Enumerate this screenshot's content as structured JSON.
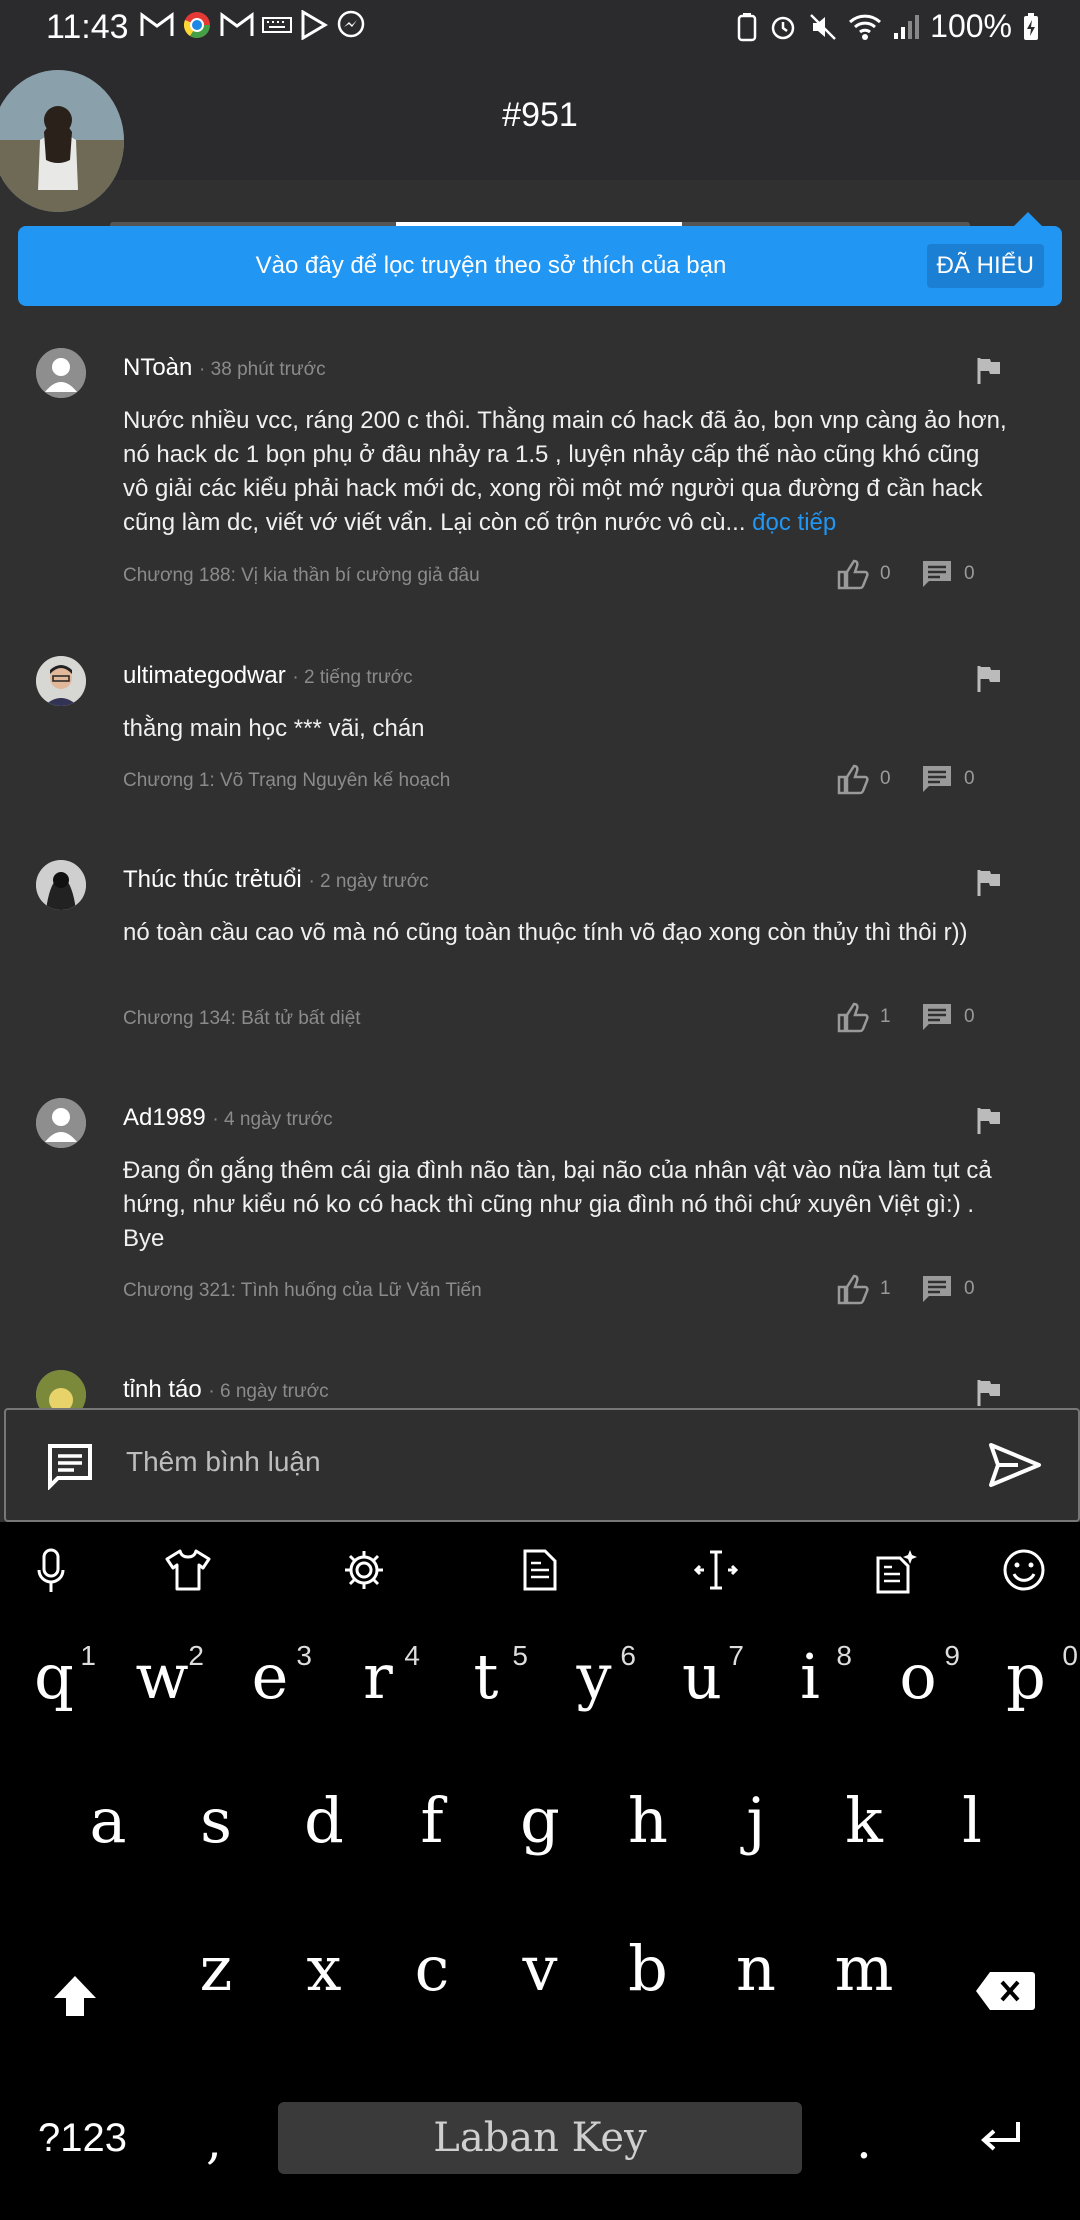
{
  "status_bar": {
    "time": "11:43",
    "battery": "100%"
  },
  "header": {
    "title": "#951"
  },
  "tooltip": {
    "text": "Vào đây để lọc truyện theo sở thích của bạn",
    "dismiss_label": "ĐÃ HIỂU"
  },
  "comments": [
    {
      "name": "NToàn",
      "time": "· 38 phút trước",
      "text": "Nước nhiều vcc, ráng 200 c thôi. Thằng main có hack đã ảo, bọn vnp càng ảo hơn, nó hack dc 1 bọn phụ ở đâu nhảy ra 1.5 , luyện nhảy cấp thế nào cũng khó cũng vô giải các kiểu phải hack mới dc, xong rồi một mớ người qua đường đ cần hack cũng làm dc, viết vớ viết vẩn. Lại còn cố trộn nước vô cù...",
      "more": "đọc tiếp",
      "chapter": "Chương 188: Vị kia thần bí cường giả đâu",
      "likes": "0",
      "replies": "0"
    },
    {
      "name": "ultimategodwar",
      "time": "· 2 tiếng trước",
      "text": "thằng main học *** vãi, chán",
      "chapter": "Chương 1: Võ Trạng Nguyên kế hoạch",
      "likes": "0",
      "replies": "0"
    },
    {
      "name": "Thúc thúc trẻtuổi",
      "time": "· 2 ngày trước",
      "text": "nó toàn cầu cao võ mà nó cũng toàn thuộc tính võ đạo xong còn thủy thì thôi r))",
      "chapter": "Chương 134: Bất tử bất diệt",
      "likes": "1",
      "replies": "0"
    },
    {
      "name": "Ad1989",
      "time": "· 4 ngày trước",
      "text": "Đang ổn gắng thêm cái gia đình não tàn, bại  não của nhân vật vào nữa làm tụt cả hứng, như kiểu nó ko có hack thì cũng như gia đình nó thôi chứ xuyên Việt gì:) . Bye",
      "chapter": "Chương 321: Tình huống của Lữ Văn Tiến",
      "likes": "1",
      "replies": "0"
    },
    {
      "name": "tỉnh táo",
      "time": "· 6 ngày trước"
    }
  ],
  "input": {
    "placeholder": "Thêm bình luận"
  },
  "keyboard": {
    "row1": [
      "q",
      "w",
      "e",
      "r",
      "t",
      "y",
      "u",
      "i",
      "o",
      "p"
    ],
    "row1_hints": [
      "1",
      "2",
      "3",
      "4",
      "5",
      "6",
      "7",
      "8",
      "9",
      "0"
    ],
    "row2": [
      "a",
      "s",
      "d",
      "f",
      "g",
      "h",
      "j",
      "k",
      "l"
    ],
    "row3": [
      "z",
      "x",
      "c",
      "v",
      "b",
      "n",
      "m"
    ],
    "symbols_label": "?123",
    "comma": ",",
    "period": ".",
    "space_label": "Laban Key"
  }
}
